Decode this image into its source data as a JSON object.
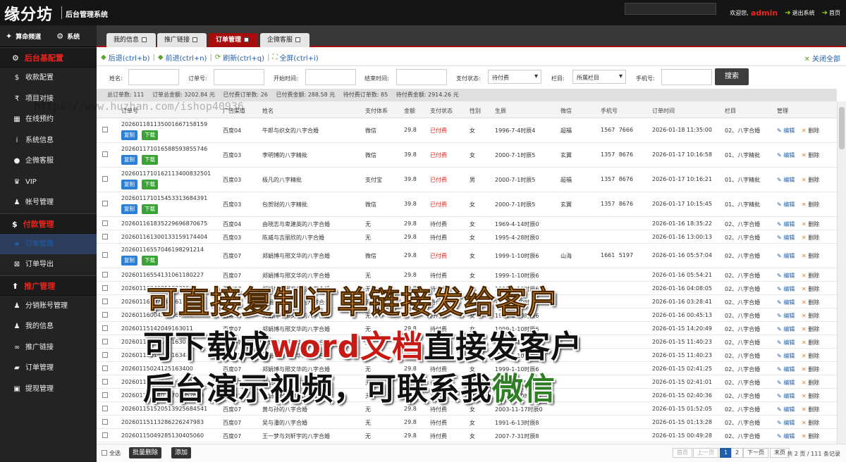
{
  "header": {
    "logo": "缘分坊",
    "subtitle": "后台管理系统",
    "welcome": "欢迎您,",
    "user": "admin",
    "logout": "退出系统",
    "home": "首页"
  },
  "sidebar": {
    "tabs": [
      "算命频道",
      "系统"
    ],
    "groups": [
      {
        "title": "后台基配置",
        "icon": "gear-icon",
        "items": [
          {
            "label": "收款配置",
            "icon": "dollar-icon"
          },
          {
            "label": "项目对接",
            "icon": "rupee-icon"
          },
          {
            "label": "在线预约",
            "icon": "calendar-icon"
          },
          {
            "label": "系统信息",
            "icon": "info-icon"
          },
          {
            "label": "企微客服",
            "icon": "chat-icon"
          },
          {
            "label": "VIP",
            "icon": "trophy-icon"
          },
          {
            "label": "帐号管理",
            "icon": "user-icon"
          }
        ]
      },
      {
        "title": "付款管理",
        "icon": "dollar-icon",
        "items": [
          {
            "label": "订单管理",
            "icon": "book-icon",
            "active": true
          },
          {
            "label": "订单导出",
            "icon": "export-icon"
          }
        ]
      },
      {
        "title": "推广管理",
        "icon": "arrow-up-icon",
        "items": [
          {
            "label": "分销账号管理",
            "icon": "users-icon"
          },
          {
            "label": "我的信息",
            "icon": "user-icon"
          },
          {
            "label": "推广链接",
            "icon": "link-icon"
          },
          {
            "label": "订单管理",
            "icon": "book-icon"
          },
          {
            "label": "提现管理",
            "icon": "money-icon"
          }
        ]
      }
    ]
  },
  "tabs": [
    {
      "label": "我的信息"
    },
    {
      "label": "推广链接"
    },
    {
      "label": "订单管理",
      "active": true
    },
    {
      "label": "企微客服"
    }
  ],
  "nav": {
    "back": "后退(ctrl+b)",
    "forward": "前进(ctrl+n)",
    "refresh": "刷新(ctrl+q)",
    "fullscreen": "全屏(ctrl+i)",
    "close_all": "关闭全部"
  },
  "search": {
    "name": "姓名:",
    "order_no": "订单号:",
    "start": "开始时间:",
    "end": "结束时间:",
    "pay_status": "支付状态:",
    "pay_status_value": "待付费",
    "column": "栏目:",
    "column_value": "所属栏目",
    "phone": "手机号:",
    "button": "搜索"
  },
  "stats": [
    "总订单数: 111",
    "订单总金额: 3202.84 元",
    "已付费订单数: 26",
    "已付费金额: 288.58 元",
    "待付费订单数: 85",
    "待付费金额: 2914.26 元"
  ],
  "table": {
    "headers": [
      "订单号",
      "广告渠道",
      "姓名",
      "支付体系",
      "金额",
      "支付状态",
      "性别",
      "生辰",
      "微信",
      "手机号",
      "订单时间",
      "栏目",
      "管理"
    ],
    "copy_label": "复制",
    "download_label": "下载",
    "edit_label": "编辑",
    "delete_label": "删除",
    "rows": [
      {
        "order": "20260118113500166715815​9",
        "channel": "百度04",
        "name": "牛郎与织女的八字合婚",
        "pay": "微信",
        "amount": "29.8",
        "status": "已付费",
        "gender": "女",
        "birth": "1996-7-4时辰4",
        "wechat": "超福",
        "phone": "1567    7666",
        "time": "2026-01-18 11:35:00",
        "column": "02、八字合婚",
        "tall": true
      },
      {
        "order": "20260117101658859385574​6",
        "channel": "百度03",
        "name": "李明博的八字精批",
        "pay": "微信",
        "amount": "39.8",
        "status": "已付费",
        "gender": "女",
        "birth": "2000-7-1时辰5",
        "wechat": "玄翼",
        "phone": "1357    8676",
        "time": "2026-01-17 10:16:58",
        "column": "01、八字精批",
        "tall": true
      },
      {
        "order": "20260117101621134008325​01",
        "channel": "百度03",
        "name": "极凡的八字精批",
        "pay": "支付宝",
        "amount": "39.8",
        "status": "已付费",
        "gender": "男",
        "birth": "2000-7-1时辰5",
        "wechat": "超福",
        "phone": "1357    8676",
        "time": "2026-01-17 10:16:21",
        "column": "01、八字精批",
        "tall": true
      },
      {
        "order": "20260117101545331368439​1",
        "channel": "百度03",
        "name": "包贺财的八字精批",
        "pay": "微信",
        "amount": "39.8",
        "status": "已付费",
        "gender": "女",
        "birth": "2000-7-1时辰5",
        "wechat": "玄翼",
        "phone": "1357    8676",
        "time": "2026-01-17 10:15:45",
        "column": "01、八字精批",
        "tall": true
      },
      {
        "order": "20260116183522969687067​5",
        "channel": "百度04",
        "name": "由晓志与卑建英的八字合婚",
        "pay": "无",
        "amount": "29.8",
        "status": "待付费",
        "gender": "女",
        "birth": "1969-4-14时辰0",
        "wechat": "",
        "phone": "",
        "time": "2026-01-16 18:35:22",
        "column": "02、八字合婚",
        "tall": false
      },
      {
        "order": "20260116130013315917440​4",
        "channel": "百度03",
        "name": "陈威与吉丽欣的八字合婚",
        "pay": "无",
        "amount": "29.8",
        "status": "待付费",
        "gender": "女",
        "birth": "1995-4-28时辰0",
        "wechat": "",
        "phone": "",
        "time": "2026-01-16 13:00:13",
        "column": "02、八字合婚",
        "tall": false
      },
      {
        "order": "20260116557046198291214",
        "channel": "百度07",
        "name": "郑娟博与邢文华的八字合婚",
        "pay": "微信",
        "amount": "29.8",
        "status": "已付费",
        "gender": "女",
        "birth": "1999-1-10时辰6",
        "wechat": "山海",
        "phone": "1661    5197",
        "time": "2026-01-16 05:57:04",
        "column": "02、八字合婚",
        "tall": true
      },
      {
        "order": "20260116554131061180227",
        "channel": "百度07",
        "name": "郑娟博与邢文华的八字合婚",
        "pay": "无",
        "amount": "29.8",
        "status": "待付费",
        "gender": "女",
        "birth": "1999-1-10时辰6",
        "wechat": "",
        "phone": "",
        "time": "2026-01-16 05:54:21",
        "column": "02、八字合婚",
        "tall": false
      },
      {
        "order": "20260116040851322150",
        "channel": "百度07",
        "name": "郑娟博与邢文华的八字合婚",
        "pay": "无",
        "amount": "29.8",
        "status": "待付费",
        "gender": "女",
        "birth": "1999-1-10时辰6",
        "wechat": "",
        "phone": "",
        "time": "2026-01-16 04:08:05",
        "column": "02、八字合婚",
        "tall": false
      },
      {
        "order": "20260116032841161850",
        "channel": "百度07",
        "name": "郑娟博与邢文华的八字合婚",
        "pay": "无",
        "amount": "29.8",
        "status": "待付费",
        "gender": "女",
        "birth": "1999-1-10时辰6",
        "wechat": "",
        "phone": "",
        "time": "2026-01-16 03:28:41",
        "column": "02、八字合婚",
        "tall": false
      },
      {
        "order": "20260116004513463481",
        "channel": "百度07",
        "name": "郑娟博与邢文华的八字合婚",
        "pay": "无",
        "amount": "29.8",
        "status": "待付费",
        "gender": "女",
        "birth": "1999-1-10时辰6",
        "wechat": "",
        "phone": "",
        "time": "2026-01-16 00:45:13",
        "column": "02、八字合婚",
        "tall": false
      },
      {
        "order": "20260115142049163011",
        "channel": "百度07",
        "name": "郑娟博与邢文华的八字合婚",
        "pay": "无",
        "amount": "29.8",
        "status": "待付费",
        "gender": "女",
        "birth": "1999-1-10时辰6",
        "wechat": "",
        "phone": "",
        "time": "2026-01-15 14:20:49",
        "column": "02、八字合婚",
        "tall": false
      },
      {
        "order": "20260115114023163023",
        "channel": "百度07",
        "name": "郑娟博与邢文华的八字合婚",
        "pay": "无",
        "amount": "29.8",
        "status": "待付费",
        "gender": "女",
        "birth": "1999-1-10时辰6",
        "wechat": "",
        "phone": "",
        "time": "2026-01-15 11:40:23",
        "column": "02、八字合婚",
        "tall": false
      },
      {
        "order": "20260115114023163489",
        "channel": "百度07",
        "name": "郑娟博与邢文华的八字合婚",
        "pay": "无",
        "amount": "29.8",
        "status": "待付费",
        "gender": "女",
        "birth": "1999-1-10时辰6",
        "wechat": "",
        "phone": "",
        "time": "2026-01-15 11:40:23",
        "column": "02、八字合婚",
        "tall": false
      },
      {
        "order": "20260115024125163400",
        "channel": "百度07",
        "name": "郑娟博与邢文华的八字合婚",
        "pay": "无",
        "amount": "29.8",
        "status": "待付费",
        "gender": "女",
        "birth": "1999-1-10时辰6",
        "wechat": "",
        "phone": "",
        "time": "2026-01-15 02:41:25",
        "column": "02、八字合婚",
        "tall": false
      },
      {
        "order": "20260115024101163401",
        "channel": "百度07",
        "name": "郑娟博与邢文华的八字合婚",
        "pay": "无",
        "amount": "29.8",
        "status": "待付费",
        "gender": "女",
        "birth": "1999-1-10时辰6",
        "wechat": "",
        "phone": "",
        "time": "2026-01-15 02:41:01",
        "column": "02、八字合婚",
        "tall": false
      },
      {
        "order": "20260115024036708152628",
        "channel": "百度07",
        "name": "郑娟博与邢文华的八字合婚",
        "pay": "无",
        "amount": "29.8",
        "status": "待付费",
        "gender": "女",
        "birth": "1999-1-10时辰6",
        "wechat": "",
        "phone": "",
        "time": "2026-01-15 02:40:36",
        "column": "02、八字合婚",
        "tall": false
      },
      {
        "order": "20260115152051392568454​1",
        "channel": "百度07",
        "name": "黄与孙的八字合婚",
        "pay": "无",
        "amount": "29.8",
        "status": "待付费",
        "gender": "女",
        "birth": "2003-11-17时辰0",
        "wechat": "",
        "phone": "",
        "time": "2026-01-15 01:52:05",
        "column": "02、八字合婚",
        "tall": false
      },
      {
        "order": "20260115113286226247983",
        "channel": "百度07",
        "name": "吴与潘的八字合婚",
        "pay": "无",
        "amount": "29.8",
        "status": "待付费",
        "gender": "女",
        "birth": "1991-6-13时辰8",
        "wechat": "",
        "phone": "",
        "time": "2026-01-15 01:13:28",
        "column": "02、八字合婚",
        "tall": false
      },
      {
        "order": "20260115049285130405060",
        "channel": "百度07",
        "name": "王一梦与刘轩宇的八字合婚",
        "pay": "无",
        "amount": "29.8",
        "status": "待付费",
        "gender": "女",
        "birth": "2007-7-31时辰8",
        "wechat": "",
        "phone": "",
        "time": "2026-01-15 00:49:28",
        "column": "02、八字合婚",
        "tall": false
      }
    ]
  },
  "footer": {
    "select_all": "全选",
    "batch_delete": "批量删除",
    "add": "添加",
    "first": "首页",
    "prev": "上一页",
    "page1": "1",
    "page2": "2",
    "next": "下一页",
    "last": "末页",
    "total": "共 2 页 / 111 条记录"
  },
  "overlay": {
    "line1": "可直接复制订单链接发给客户",
    "line2a": "可下载成",
    "line2b": "word文档",
    "line2c": "直接发客户",
    "line3a": "后台演示视频，可联系我",
    "line3b": "微信"
  },
  "watermark": "https://www.huzhan.com/ishop40936",
  "colors": {
    "accent_red": "#a80d0d",
    "paid": "#e8261d",
    "link": "#1f5ea8",
    "copy_btn": "#2b7fd4",
    "download_btn": "#3aa335"
  }
}
